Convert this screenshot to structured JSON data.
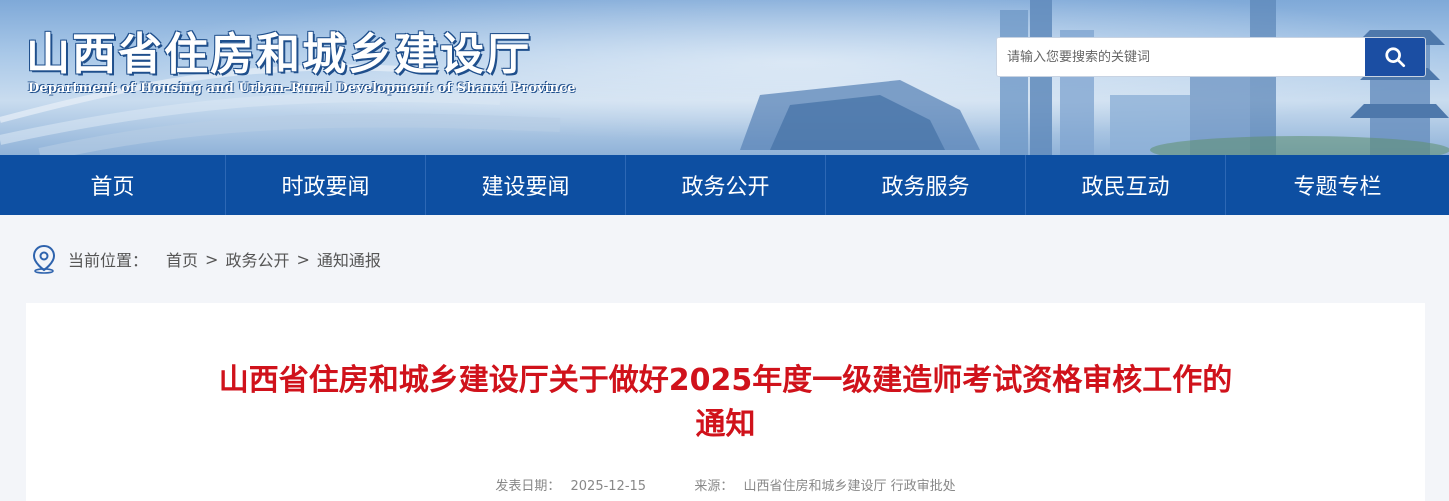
{
  "header": {
    "title": "山西省住房和城乡建设厅",
    "subtitle": "Department of Housing and Urban–Rural Development of Shanxi Province",
    "search": {
      "placeholder": "请输入您要搜索的关键词",
      "value": ""
    },
    "search_icon": "search-icon"
  },
  "nav": {
    "items": [
      {
        "label": "首页"
      },
      {
        "label": "时政要闻"
      },
      {
        "label": "建设要闻"
      },
      {
        "label": "政务公开"
      },
      {
        "label": "政务服务"
      },
      {
        "label": "政民互动"
      },
      {
        "label": "专题专栏"
      }
    ]
  },
  "breadcrumb": {
    "icon": "location-pin-icon",
    "label": "当前位置：",
    "items": [
      "首页",
      "政务公开",
      "通知通报"
    ],
    "separator": ">"
  },
  "article": {
    "title_line1": "山西省住房和城乡建设厅关于做好2025年度一级建造师考试资格审核工作的",
    "title_line2": "通知",
    "date_label": "发表日期：",
    "date": "2025-12-15",
    "source_label": "来源：",
    "source": "山西省住房和城乡建设厅 行政审批处"
  },
  "colors": {
    "nav_bg": "#0d4fa2",
    "title_red": "#d0121b",
    "search_button": "#1b4ea3"
  }
}
